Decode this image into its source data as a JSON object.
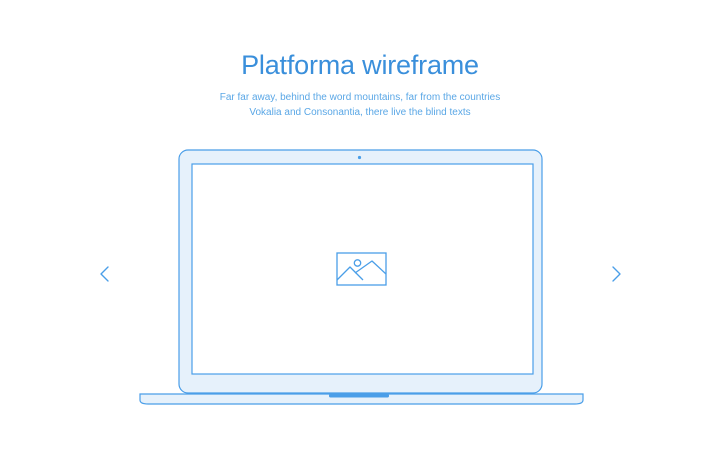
{
  "hero": {
    "title": "Platforma wireframe",
    "subtitle_line1": "Far far away, behind the word mountains, far from the countries",
    "subtitle_line2": "Vokalia and Consonantia, there live the blind texts"
  },
  "carousel": {
    "prev_icon": "chevron-left-icon",
    "next_icon": "chevron-right-icon",
    "slide_icon": "image-placeholder-icon"
  },
  "colors": {
    "accent": "#3a8fdb",
    "accent_light": "#5aa7e6",
    "stroke": "#4a9ee8",
    "fill_light": "#e6f1fb",
    "background": "#ffffff"
  }
}
